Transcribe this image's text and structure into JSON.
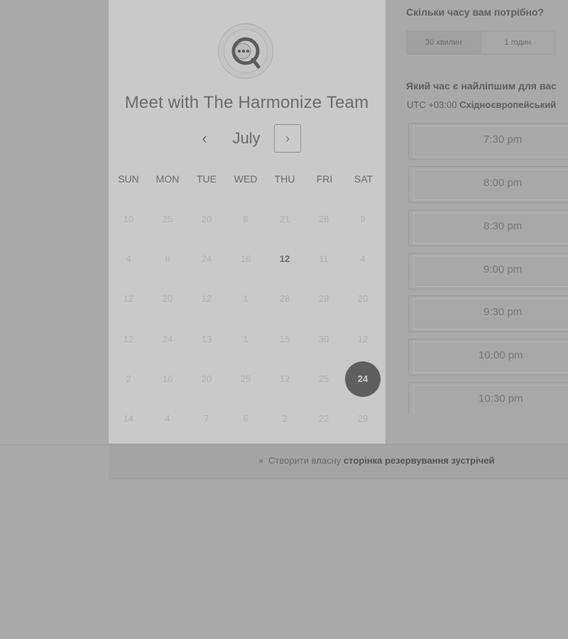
{
  "calendar": {
    "title": "Meet with The Harmonize Team",
    "month": "July",
    "prev_icon": "‹",
    "next_icon": "›",
    "weekdays": [
      "SUN",
      "MON",
      "TUE",
      "WED",
      "THU",
      "FRI",
      "SAT"
    ],
    "weeks": [
      [
        "10",
        "25",
        "20",
        "8",
        "21",
        "26",
        "9"
      ],
      [
        "4",
        "6",
        "24",
        "16",
        "12",
        "11",
        "4"
      ],
      [
        "12",
        "20",
        "12",
        "1",
        "28",
        "29",
        "20"
      ],
      [
        "12",
        "24",
        "13",
        "1",
        "15",
        "30",
        "12"
      ],
      [
        "2",
        "16",
        "20",
        "25",
        "12",
        "25",
        "24"
      ],
      [
        "14",
        "4",
        "7",
        "6",
        "2",
        "22",
        "29"
      ]
    ],
    "highlighted_day": "12",
    "selected_day": "24"
  },
  "duration": {
    "question": "Скільки часу вам потрібно?",
    "options": [
      "30 хвилин",
      "1 годин"
    ],
    "selected": "30 хвилин"
  },
  "time_slots": {
    "question": "Який час є найліпшим для вас",
    "timezone_offset": "UTC +03:00",
    "timezone_name": "Східноєвропейський",
    "slots": [
      "7:30 pm",
      "8:00 pm",
      "8:30 pm",
      "9:00 pm",
      "9:30 pm",
      "10:00 pm",
      "10:30 pm"
    ]
  },
  "footer": {
    "icon": "»",
    "text_prefix": "Створити власну",
    "text_bold": "сторінка резервування зустрічей"
  }
}
